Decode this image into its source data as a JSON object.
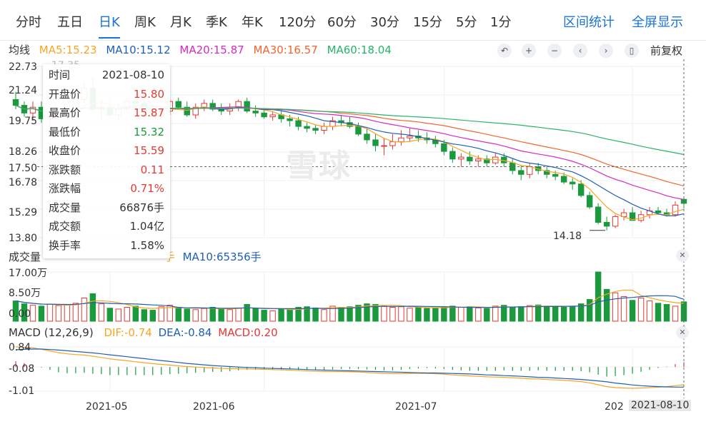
{
  "tabs": [
    "分时",
    "五日",
    "日K",
    "周K",
    "月K",
    "季K",
    "年K",
    "120分",
    "60分",
    "30分",
    "15分",
    "5分",
    "1分"
  ],
  "active_tab": "日K",
  "right_links": {
    "stats": "区间统计",
    "fullscreen": "全屏显示"
  },
  "ma_legend": {
    "title": "均线",
    "items": [
      {
        "label": "MA5:15.23",
        "color": "#f5a623"
      },
      {
        "label": "MA10:15.12",
        "color": "#1f5fb4"
      },
      {
        "label": "MA20:15.87",
        "color": "#d62ac0"
      },
      {
        "label": "MA30:16.57",
        "color": "#f0662e"
      },
      {
        "label": "MA60:18.04",
        "color": "#26b36a"
      }
    ]
  },
  "toolbar": {
    "icons": [
      "undo-icon",
      "zoom-in-icon",
      "zoom-out-icon",
      "pan-left-icon",
      "pan-right-icon",
      "candle-icon"
    ],
    "glyphs": [
      "↶",
      "+",
      "−",
      "‹",
      "›",
      "▯"
    ],
    "adjust": "前复权"
  },
  "price_axis": {
    "labels": [
      "22.73",
      "21.24",
      "19.75",
      "18.26",
      "16.78",
      "15.29",
      "13.80"
    ],
    "crosshair_label": "17.50"
  },
  "low_marker": "14.18",
  "top_partial_text": "17.35",
  "volume_panel": {
    "legend": "成交量",
    "ma5": "手",
    "ma10": "MA10:65356手",
    "axis": [
      "17.00万",
      "8.50万",
      "0.00"
    ]
  },
  "macd_panel": {
    "legend": "MACD (12,26,9)",
    "dif": "DIF:-0.74",
    "dea": "DEA:-0.84",
    "macd": "MACD:0.20",
    "axis": [
      "0.84",
      "-0.08",
      "-1.01"
    ]
  },
  "date_axis": {
    "labels": [
      "2021-05",
      "2021-06",
      "2021-07",
      "202"
    ],
    "crosshair_label": "2021-08-10"
  },
  "tooltip": [
    {
      "k": "时间",
      "v": "2021-08-10",
      "c": "#333333"
    },
    {
      "k": "开盘价",
      "v": "15.80",
      "c": "#e53935"
    },
    {
      "k": "最高价",
      "v": "15.87",
      "c": "#e53935"
    },
    {
      "k": "最低价",
      "v": "15.32",
      "c": "#1a9a3c"
    },
    {
      "k": "收盘价",
      "v": "15.59",
      "c": "#e53935"
    },
    {
      "k": "涨跌额",
      "v": "0.11",
      "c": "#e53935"
    },
    {
      "k": "涨跌幅",
      "v": "0.71%",
      "c": "#e53935"
    },
    {
      "k": "成交量",
      "v": "66876手",
      "c": "#333333"
    },
    {
      "k": "成交额",
      "v": "1.04亿",
      "c": "#333333"
    },
    {
      "k": "换手率",
      "v": "1.58%",
      "c": "#333333"
    }
  ],
  "watermark": "雪球",
  "colors": {
    "up": "#e53935",
    "down": "#1a9a3c",
    "ma5": "#f5a623",
    "ma10": "#1f5fb4",
    "ma20": "#d62ac0",
    "ma30": "#f0662e",
    "ma60": "#26b36a",
    "dif": "#f5a623",
    "dea": "#1f5fb4"
  },
  "chart_data": {
    "type": "candlestick",
    "price_range": [
      13.8,
      22.73
    ],
    "dates": [
      "2021-04-16",
      "2021-04-19",
      "2021-04-20",
      "2021-04-21",
      "2021-04-22",
      "2021-04-23",
      "2021-04-26",
      "2021-04-27",
      "2021-04-28",
      "2021-04-29",
      "2021-04-30",
      "2021-05-06",
      "2021-05-07",
      "2021-05-10",
      "2021-05-11",
      "2021-05-12",
      "2021-05-13",
      "2021-05-14",
      "2021-05-17",
      "2021-05-18",
      "2021-05-19",
      "2021-05-20",
      "2021-05-21",
      "2021-05-24",
      "2021-05-25",
      "2021-05-26",
      "2021-05-27",
      "2021-05-28",
      "2021-05-31",
      "2021-06-01",
      "2021-06-02",
      "2021-06-03",
      "2021-06-04",
      "2021-06-07",
      "2021-06-08",
      "2021-06-09",
      "2021-06-10",
      "2021-06-11",
      "2021-06-15",
      "2021-06-16",
      "2021-06-17",
      "2021-06-18",
      "2021-06-21",
      "2021-06-22",
      "2021-06-23",
      "2021-06-24",
      "2021-06-25",
      "2021-06-28",
      "2021-06-29",
      "2021-06-30",
      "2021-07-01",
      "2021-07-02",
      "2021-07-05",
      "2021-07-06",
      "2021-07-07",
      "2021-07-08",
      "2021-07-09",
      "2021-07-12",
      "2021-07-13",
      "2021-07-14",
      "2021-07-15",
      "2021-07-16",
      "2021-07-19",
      "2021-07-20",
      "2021-07-21",
      "2021-07-22",
      "2021-07-23",
      "2021-07-26",
      "2021-07-27",
      "2021-07-28",
      "2021-07-29",
      "2021-07-30",
      "2021-08-02",
      "2021-08-03",
      "2021-08-04",
      "2021-08-05",
      "2021-08-06",
      "2021-08-09",
      "2021-08-10"
    ],
    "open": [
      21.0,
      20.7,
      20.3,
      20.6,
      20.0,
      20.1,
      20.3,
      20.5,
      21.0,
      21.6,
      20.5,
      20.6,
      20.2,
      20.5,
      20.9,
      20.8,
      20.4,
      20.1,
      20.4,
      20.9,
      20.6,
      20.2,
      20.6,
      20.8,
      20.5,
      20.4,
      20.6,
      20.9,
      20.4,
      20.3,
      20.1,
      20.2,
      20.0,
      19.9,
      19.6,
      19.5,
      19.4,
      19.6,
      19.9,
      19.8,
      19.6,
      19.2,
      18.9,
      18.6,
      18.6,
      18.8,
      19.0,
      19.1,
      19.0,
      18.9,
      18.7,
      18.3,
      17.9,
      18.0,
      17.8,
      17.9,
      17.7,
      18.0,
      17.7,
      17.3,
      17.1,
      17.5,
      17.3,
      17.1,
      17.0,
      16.7,
      16.6,
      16.0,
      15.4,
      14.6,
      14.4,
      14.9,
      15.1,
      14.7,
      15.0,
      15.2,
      15.1,
      15.0,
      15.8
    ],
    "high": [
      21.4,
      20.9,
      20.9,
      20.9,
      20.4,
      20.6,
      20.8,
      21.2,
      21.9,
      22.2,
      21.0,
      21.0,
      20.8,
      21.1,
      21.2,
      21.1,
      20.7,
      20.6,
      21.0,
      21.1,
      20.9,
      20.8,
      21.0,
      21.0,
      20.8,
      20.8,
      21.0,
      21.1,
      20.7,
      20.5,
      20.4,
      20.4,
      20.2,
      20.1,
      19.8,
      19.7,
      19.8,
      20.1,
      20.2,
      20.1,
      19.8,
      19.5,
      19.2,
      19.0,
      19.2,
      19.4,
      19.5,
      19.4,
      19.3,
      19.1,
      18.9,
      18.5,
      18.2,
      18.3,
      18.1,
      18.1,
      18.2,
      18.2,
      17.9,
      17.6,
      17.7,
      17.7,
      17.5,
      17.3,
      17.2,
      16.9,
      16.8,
      16.2,
      15.6,
      14.9,
      15.0,
      15.3,
      15.4,
      15.2,
      15.4,
      15.4,
      15.3,
      15.7,
      15.87
    ],
    "low": [
      20.5,
      20.1,
      19.9,
      19.8,
      19.4,
      19.9,
      20.0,
      20.4,
      20.8,
      20.4,
      20.0,
      20.1,
      19.9,
      20.3,
      20.5,
      20.3,
      20.0,
      19.9,
      20.2,
      20.5,
      20.1,
      20.0,
      20.4,
      20.4,
      20.2,
      20.2,
      20.4,
      20.3,
      20.1,
      20.0,
      19.9,
      19.8,
      19.6,
      19.4,
      19.3,
      19.2,
      19.2,
      19.4,
      19.6,
      19.5,
      19.1,
      18.7,
      18.3,
      18.1,
      18.4,
      18.6,
      18.8,
      18.8,
      18.7,
      18.5,
      18.1,
      17.7,
      17.5,
      17.6,
      17.5,
      17.5,
      17.6,
      17.5,
      17.1,
      16.8,
      16.9,
      17.1,
      16.9,
      16.8,
      16.6,
      16.3,
      15.9,
      15.3,
      14.5,
      14.18,
      14.3,
      14.7,
      14.8,
      14.6,
      14.8,
      15.0,
      14.9,
      14.9,
      15.32
    ],
    "close": [
      20.7,
      20.3,
      20.6,
      20.0,
      20.1,
      20.3,
      20.5,
      21.0,
      21.6,
      20.5,
      20.6,
      20.2,
      20.5,
      20.9,
      20.8,
      20.4,
      20.1,
      20.4,
      20.9,
      20.6,
      20.2,
      20.6,
      20.8,
      20.5,
      20.4,
      20.6,
      20.9,
      20.4,
      20.3,
      20.1,
      20.2,
      20.0,
      19.9,
      19.6,
      19.5,
      19.4,
      19.6,
      19.9,
      19.8,
      19.6,
      19.2,
      18.9,
      18.6,
      18.6,
      18.8,
      19.0,
      19.1,
      19.0,
      18.9,
      18.7,
      18.3,
      17.9,
      18.0,
      17.8,
      17.9,
      17.7,
      18.0,
      17.7,
      17.3,
      17.1,
      17.5,
      17.3,
      17.1,
      17.0,
      16.7,
      16.6,
      16.0,
      15.4,
      14.6,
      14.4,
      14.9,
      15.1,
      14.7,
      15.0,
      15.2,
      15.1,
      15.0,
      15.5,
      15.59
    ],
    "volume_range": [
      0,
      170000
    ],
    "volume": [
      70000,
      60000,
      55000,
      52000,
      58000,
      54000,
      56000,
      62000,
      80000,
      95000,
      60000,
      45000,
      42000,
      48000,
      52000,
      40000,
      38000,
      50000,
      55000,
      48000,
      42000,
      40000,
      44000,
      48000,
      42000,
      40000,
      45000,
      58000,
      44000,
      38000,
      36000,
      42000,
      40000,
      48000,
      50000,
      46000,
      40000,
      52000,
      48000,
      50000,
      55000,
      60000,
      58000,
      52000,
      48000,
      50000,
      45000,
      48000,
      44000,
      46000,
      50000,
      52000,
      48000,
      50000,
      46000,
      44000,
      52000,
      55000,
      48000,
      50000,
      54000,
      56000,
      52000,
      50000,
      48000,
      52000,
      60000,
      75000,
      170000,
      110000,
      98000,
      85000,
      72000,
      80000,
      70000,
      62000,
      58000,
      52000,
      66876
    ],
    "macd_range": [
      -1.01,
      0.84
    ],
    "dif": [
      0.84,
      0.82,
      0.8,
      0.74,
      0.67,
      0.6,
      0.55,
      0.52,
      0.5,
      0.45,
      0.4,
      0.34,
      0.3,
      0.26,
      0.22,
      0.18,
      0.14,
      0.11,
      0.08,
      0.05,
      0.02,
      0.0,
      -0.02,
      -0.04,
      -0.06,
      -0.07,
      -0.07,
      -0.08,
      -0.09,
      -0.1,
      -0.11,
      -0.12,
      -0.13,
      -0.15,
      -0.17,
      -0.18,
      -0.19,
      -0.19,
      -0.19,
      -0.2,
      -0.21,
      -0.23,
      -0.25,
      -0.27,
      -0.28,
      -0.28,
      -0.27,
      -0.27,
      -0.27,
      -0.28,
      -0.3,
      -0.33,
      -0.35,
      -0.37,
      -0.39,
      -0.41,
      -0.42,
      -0.43,
      -0.45,
      -0.47,
      -0.49,
      -0.5,
      -0.52,
      -0.54,
      -0.56,
      -0.58,
      -0.61,
      -0.66,
      -0.74,
      -0.82,
      -0.86,
      -0.88,
      -0.89,
      -0.88,
      -0.86,
      -0.84,
      -0.82,
      -0.78,
      -0.74
    ],
    "dea": [
      0.72,
      0.74,
      0.75,
      0.75,
      0.73,
      0.71,
      0.68,
      0.65,
      0.62,
      0.59,
      0.55,
      0.51,
      0.47,
      0.43,
      0.39,
      0.35,
      0.31,
      0.27,
      0.23,
      0.19,
      0.15,
      0.12,
      0.09,
      0.06,
      0.04,
      0.02,
      0.0,
      -0.02,
      -0.03,
      -0.05,
      -0.06,
      -0.07,
      -0.08,
      -0.09,
      -0.11,
      -0.12,
      -0.13,
      -0.14,
      -0.15,
      -0.16,
      -0.17,
      -0.18,
      -0.19,
      -0.2,
      -0.21,
      -0.22,
      -0.23,
      -0.24,
      -0.25,
      -0.25,
      -0.26,
      -0.27,
      -0.28,
      -0.29,
      -0.31,
      -0.33,
      -0.34,
      -0.36,
      -0.37,
      -0.39,
      -0.41,
      -0.43,
      -0.44,
      -0.46,
      -0.48,
      -0.5,
      -0.52,
      -0.55,
      -0.58,
      -0.62,
      -0.67,
      -0.71,
      -0.75,
      -0.78,
      -0.8,
      -0.82,
      -0.83,
      -0.84,
      -0.84
    ]
  }
}
